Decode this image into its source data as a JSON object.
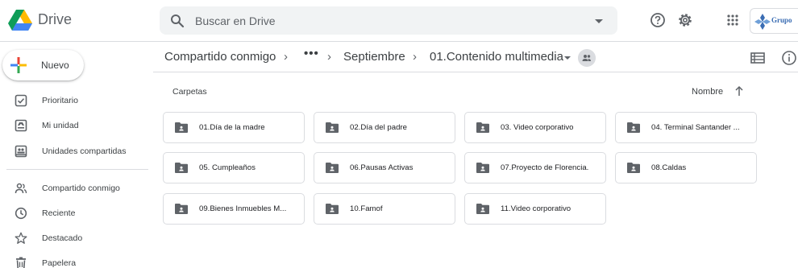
{
  "app": {
    "name": "Drive"
  },
  "search": {
    "placeholder": "Buscar en Drive"
  },
  "org": {
    "name": "Grupo"
  },
  "new_button": {
    "label": "Nuevo"
  },
  "sidebar": {
    "items": [
      {
        "label": "Prioritario",
        "icon": "priority-check-icon"
      },
      {
        "label": "Mi unidad",
        "icon": "my-drive-icon"
      },
      {
        "label": "Unidades compartidas",
        "icon": "shared-drives-icon"
      },
      {
        "label": "Compartido conmigo",
        "icon": "shared-with-me-icon"
      },
      {
        "label": "Reciente",
        "icon": "clock-icon"
      },
      {
        "label": "Destacado",
        "icon": "star-icon"
      },
      {
        "label": "Papelera",
        "icon": "trash-icon"
      }
    ]
  },
  "breadcrumb": {
    "items": [
      "Compartido conmigo",
      "Septiembre",
      "01.Contenido multimedia"
    ],
    "overflow": "•••",
    "separator": "›"
  },
  "section": {
    "folders_label": "Carpetas",
    "sort_label": "Nombre"
  },
  "folders": [
    "01.Día de la madre",
    "02.Día del padre",
    "03. Video corporativo",
    "04. Terminal Santander ...",
    "05. Cumpleaños",
    "06.Pausas Activas",
    "07.Proyecto de Florencia.",
    "08.Caldas",
    "09.Bienes Inmuebles M...",
    "10.Famof",
    "11.Video corporativo"
  ],
  "colors": {
    "accent_blue": "#1a73e8",
    "icon_gray": "#5f6368",
    "border": "#dadce0",
    "folder": "#5f6368"
  }
}
